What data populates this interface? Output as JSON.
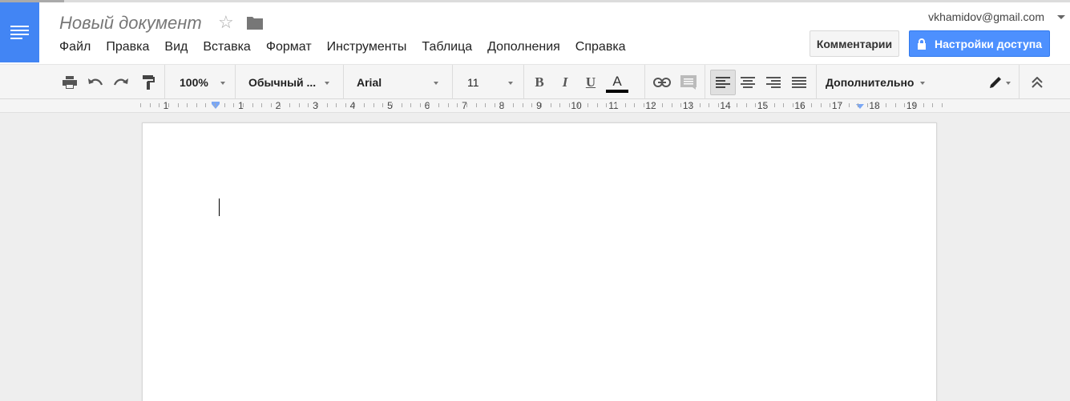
{
  "document": {
    "title": "Новый документ"
  },
  "menu": [
    "Файл",
    "Правка",
    "Вид",
    "Вставка",
    "Формат",
    "Инструменты",
    "Таблица",
    "Дополнения",
    "Справка"
  ],
  "user": {
    "email": "vkhamidov@gmail.com"
  },
  "buttons": {
    "comments": "Комментарии",
    "share": "Настройки доступа"
  },
  "toolbar": {
    "zoom": "100%",
    "style": "Обычный ...",
    "font": "Arial",
    "size": "11",
    "bold": "B",
    "italic": "I",
    "underline": "U",
    "text_color": "A",
    "more": "Дополнительно"
  },
  "ruler": {
    "left_numbers": [
      "1"
    ],
    "numbers": [
      "1",
      "2",
      "3",
      "4",
      "5",
      "6",
      "7",
      "8",
      "9",
      "10",
      "11",
      "12",
      "13",
      "14",
      "15",
      "16",
      "17",
      "18",
      "19"
    ]
  },
  "colors": {
    "brand": "#4285f4",
    "share_button": "#4d90fe"
  }
}
